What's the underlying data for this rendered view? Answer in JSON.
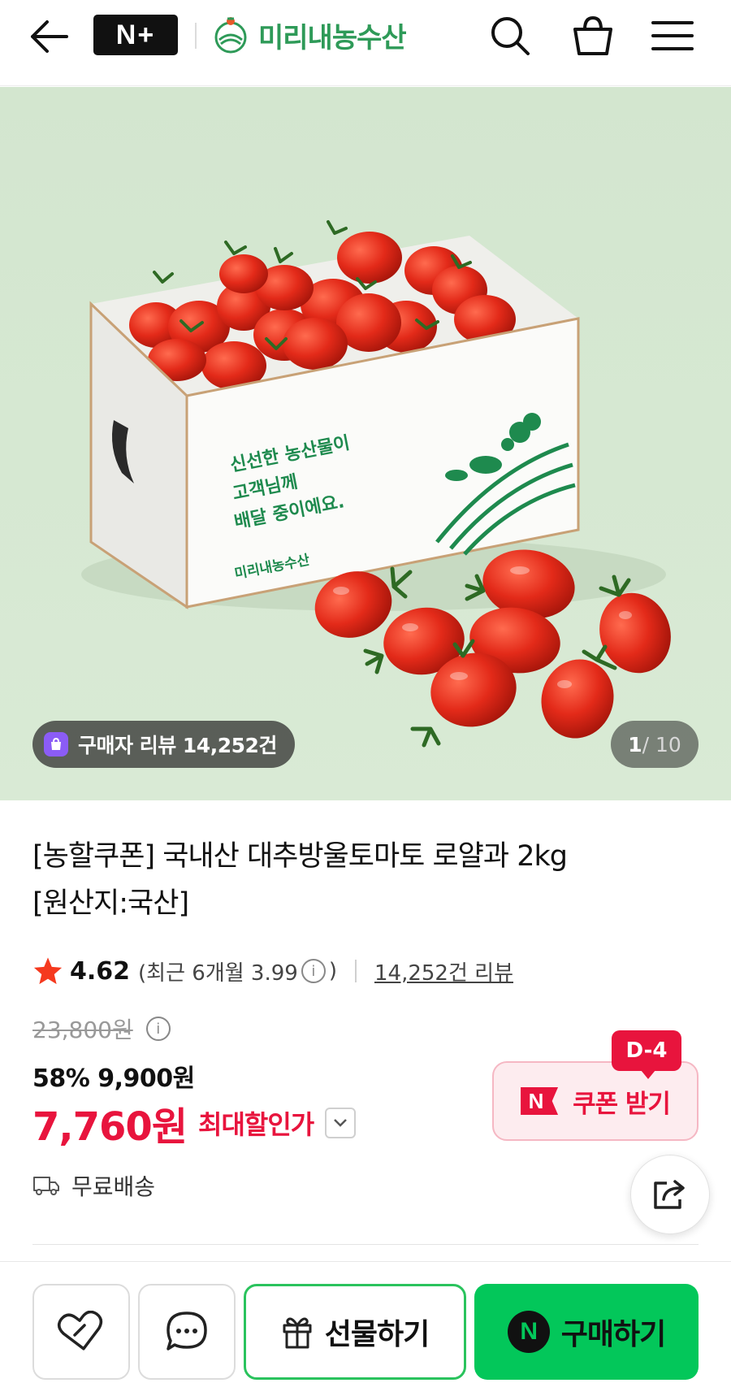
{
  "header": {
    "brand_badge": "N+",
    "store_name": "미리내농수산",
    "icons": [
      "back-arrow-icon",
      "search-icon",
      "shopping-bag-icon",
      "menu-icon"
    ]
  },
  "product_image": {
    "box_text_line1": "신선한 농산물이",
    "box_text_line2": "고객님께",
    "box_text_line3": "배달 중이에요.",
    "box_brand": "미리내농수산",
    "review_badge": "구매자 리뷰 14,252건",
    "page_current": "1",
    "page_total": "/ 10"
  },
  "product": {
    "title_line1": "[농할쿠폰] 국내산 대추방울토마토 로얄과 2kg",
    "title_line2": "[원산지:국산]"
  },
  "rating": {
    "score": "4.62",
    "recent_prefix": "(최근 6개월 3.99",
    "recent_suffix": ")",
    "review_count": "14,252건 리뷰",
    "star_color": "#f5391e"
  },
  "price": {
    "original": "23,800원",
    "sale": "58% 9,900원",
    "max_discount_price": "7,760원",
    "max_discount_label": "최대할인가",
    "accent_color": "#e8143d"
  },
  "coupon": {
    "dday": "D-4",
    "badge": "N",
    "label": "쿠폰 받기"
  },
  "shipping": {
    "label": "무료배송"
  },
  "bottom_bar": {
    "gift_label": "선물하기",
    "buy_badge": "N",
    "buy_label": "구매하기",
    "buy_color": "#03c75a"
  }
}
